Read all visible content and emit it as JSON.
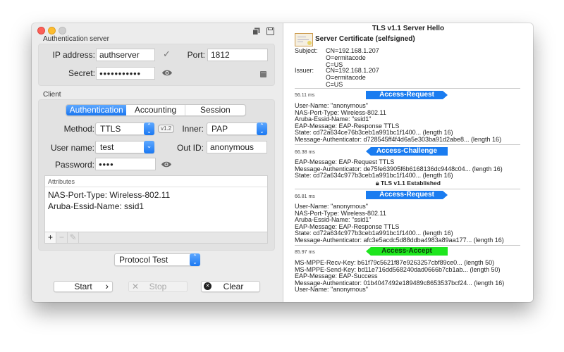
{
  "window": {
    "controls": [
      "close",
      "minimize",
      "zoom"
    ],
    "toolbar_icons": [
      "copy-icon",
      "save-icon"
    ]
  },
  "auth_server": {
    "section_label": "Authentication server",
    "ip_label": "IP address:",
    "ip_value": "authserver",
    "ip_status_icon": "checkmark-icon",
    "port_label": "Port:",
    "port_value": "1812",
    "secret_label": "Secret:",
    "secret_value": "●●●●●●●●●●●",
    "secret_reveal_icon": "eye-icon",
    "storage_icon": "drawer-icon"
  },
  "client": {
    "section_label": "Client",
    "tabs": [
      {
        "label": "Authentication",
        "active": true
      },
      {
        "label": "Accounting",
        "active": false
      },
      {
        "label": "Session",
        "active": false
      }
    ],
    "method_label": "Method:",
    "method_value": "TTLS",
    "tls_version_badge": "v1.2",
    "inner_label": "Inner:",
    "inner_value": "PAP",
    "username_label": "User name:",
    "username_value": "test",
    "outid_label": "Out ID:",
    "outid_value": "anonymous",
    "password_label": "Password:",
    "password_value": "●●●●",
    "password_reveal_icon": "eye-icon",
    "attributes": {
      "header": "Attributes",
      "rows": [
        "NAS-Port-Type: Wireless-802.11",
        "Aruba-Essid-Name: ssid1"
      ],
      "toolbar": {
        "add": "+",
        "remove": "−",
        "edit": "✎"
      }
    }
  },
  "test_mode": {
    "selected": "Protocol Test"
  },
  "actions": {
    "start_label": "Start",
    "start_glyph": "›",
    "stop_label": "Stop",
    "stop_glyph": "✕",
    "stop_enabled": false,
    "clear_label": "Clear",
    "clear_glyph": "✖"
  },
  "log": {
    "title": "TLS v1.1 Server Hello",
    "certificate": {
      "title": "Server Certificate (selfsigned)",
      "subject_label": "Subject:",
      "subject": [
        "CN=192.168.1.207",
        "O=ermitacode",
        "C=US"
      ],
      "issuer_label": "Issuer:",
      "issuer": [
        "CN=192.168.1.207",
        "O=ermitacode",
        "C=US"
      ]
    },
    "packets": [
      {
        "time": "56.11 ms",
        "type": "Access-Request",
        "direction": "outgoing",
        "color": "#1a7cf0",
        "lines": [
          "User-Name: \"anonymous\"",
          "NAS-Port-Type: Wireless-802.11",
          "Aruba-Essid-Name: \"ssid1\"",
          "EAP-Message: EAP-Response TTLS",
          "State: cd72a634ce76b3ceb1a991bc1f1400... (length 16)",
          "Message-Authenticator: d728545ff4f4d6a5e303ba91d2abe8... (length 16)"
        ]
      },
      {
        "time": "66.38 ms",
        "type": "Access-Challenge",
        "direction": "incoming",
        "color": "#1a7cf0",
        "lines": [
          "EAP-Message: EAP-Request TTLS",
          "Message-Authenticator: de75fe63905f6b6168136dc9448c04... (length 16)",
          "State: cd72a634c977b3ceb1a991bc1f1400... (length 16)"
        ],
        "note": "TLS v1.1 Established",
        "note_icon": "lock-icon"
      },
      {
        "time": "66.81 ms",
        "type": "Access-Request",
        "direction": "outgoing",
        "color": "#1a7cf0",
        "lines": [
          "User-Name: \"anonymous\"",
          "NAS-Port-Type: Wireless-802.11",
          "Aruba-Essid-Name: \"ssid1\"",
          "EAP-Message: EAP-Response TTLS",
          "State: cd72a634c977b3ceb1a991bc1f1400... (length 16)",
          "Message-Authenticator: afc3e5acdc5d88ddba4983a89aa177... (length 16)"
        ]
      },
      {
        "time": "85.97 ms",
        "type": "Access-Accept",
        "direction": "incoming",
        "color": "#1ee61e",
        "lines": [
          "MS-MPPE-Recv-Key: b61f79c5621f87e9263257cbf89ce0... (length 50)",
          "MS-MPPE-Send-Key: bd11e716dd568240dad0666b7cb1ab... (length 50)",
          "EAP-Message: EAP-Success",
          "Message-Authenticator: 01b4047492e189489c8653537bcf24... (length 16)",
          "User-Name: \"anonymous\""
        ]
      }
    ]
  }
}
